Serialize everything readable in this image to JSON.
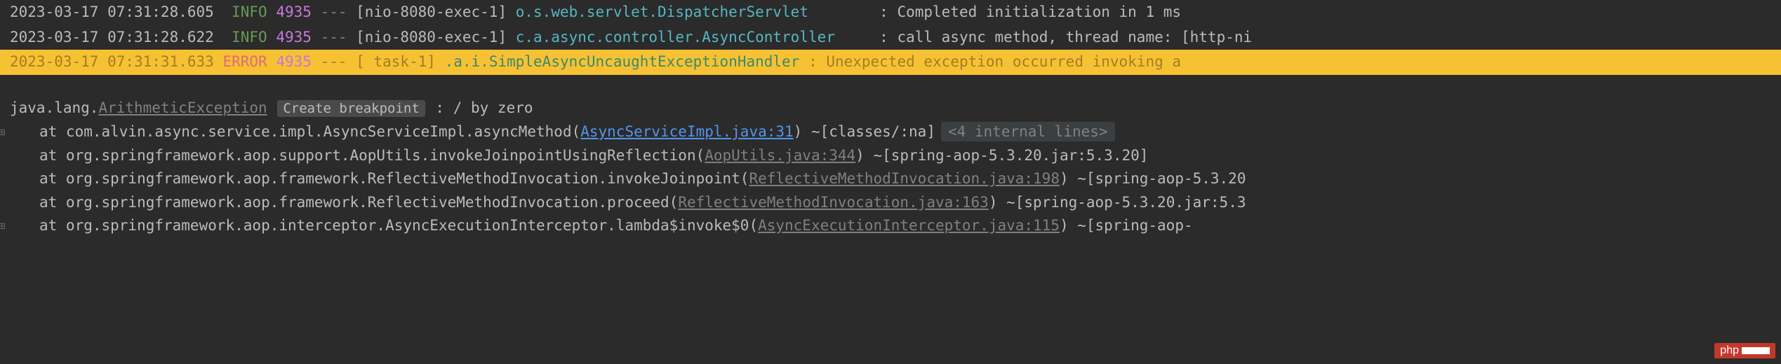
{
  "lines": [
    {
      "timestamp": "2023-03-17 07:31:28.605",
      "level": "INFO",
      "pid": "4935",
      "dashes": "---",
      "thread": "[nio-8080-exec-1]",
      "logger": "o.s.web.servlet.DispatcherServlet",
      "sep": ":",
      "msg": "Completed initialization in 1 ms"
    },
    {
      "timestamp": "2023-03-17 07:31:28.622",
      "level": "INFO",
      "pid": "4935",
      "dashes": "---",
      "thread": "[nio-8080-exec-1]",
      "logger": "c.a.async.controller.AsyncController",
      "sep": ":",
      "msg": "call async method, thread name: [http-ni"
    },
    {
      "timestamp": "2023-03-17 07:31:31.633",
      "level": "ERROR",
      "pid": "4935",
      "dashes": "---",
      "thread": "[         task-1]",
      "logger": ".a.i.SimpleAsyncUncaughtExceptionHandler",
      "sep": ":",
      "msg": "Unexpected exception occurred invoking a"
    }
  ],
  "exception": {
    "prefix": "java.lang.",
    "name": "ArithmeticException",
    "breakpoint": "Create breakpoint",
    "suffix": " : / by zero"
  },
  "stack": [
    {
      "prefix": "at com.alvin.async.service.impl.AsyncServiceImpl.asyncMethod(",
      "link": "AsyncServiceImpl.java:31",
      "linkType": "blue",
      "suffix": ") ~[classes/:na]",
      "internal": "<4 internal lines>",
      "gutter": true
    },
    {
      "prefix": "at org.springframework.aop.support.AopUtils.invokeJoinpointUsingReflection(",
      "link": "AopUtils.java:344",
      "linkType": "gray",
      "suffix": ") ~[spring-aop-5.3.20.jar:5.3.20]"
    },
    {
      "prefix": "at org.springframework.aop.framework.ReflectiveMethodInvocation.invokeJoinpoint(",
      "link": "ReflectiveMethodInvocation.java:198",
      "linkType": "gray",
      "suffix": ") ~[spring-aop-5.3.20"
    },
    {
      "prefix": "at org.springframework.aop.framework.ReflectiveMethodInvocation.proceed(",
      "link": "ReflectiveMethodInvocation.java:163",
      "linkType": "gray",
      "suffix": ") ~[spring-aop-5.3.20.jar:5.3"
    },
    {
      "prefix": "at org.springframework.aop.interceptor.AsyncExecutionInterceptor.lambda$invoke$0(",
      "link": "AsyncExecutionInterceptor.java:115",
      "linkType": "gray",
      "suffix": ") ~[spring-aop-",
      "gutter": true
    }
  ],
  "watermark": "php"
}
